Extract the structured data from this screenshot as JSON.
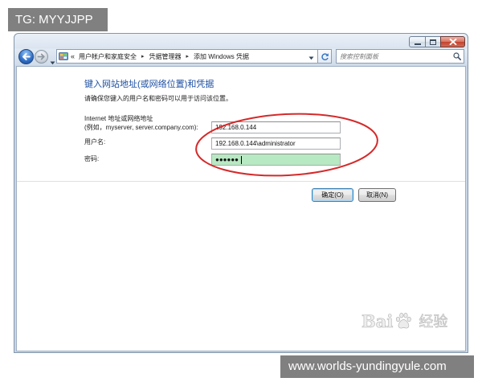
{
  "watermarks": {
    "top_left": "TG: MYYJJPP",
    "bottom_right": "www.worlds-yundingyule.com",
    "baidu_prefix": "Bai",
    "baidu_suffix": "经验"
  },
  "window": {
    "address": {
      "overflow": "«",
      "separator": "▸",
      "breadcrumbs": [
        "用户帐户和家庭安全",
        "凭据管理器",
        "添加 Windows 凭据"
      ]
    },
    "search": {
      "placeholder": "搜索控制面板"
    }
  },
  "form": {
    "heading": "键入网站地址(或网络位置)和凭据",
    "description": "请确保您键入的用户名和密码可以用于访问该位置。",
    "address_label": "Internet 地址或网络地址",
    "address_example": "(例如，myserver, server.company.com):",
    "address_value": "192.168.0.144",
    "username_label": "用户名:",
    "username_value": "192.168.0.144\\administrator",
    "password_label": "密码:",
    "password_value": "●●●●●●"
  },
  "buttons": {
    "ok": "确定(O)",
    "cancel": "取消(N)"
  },
  "icons": {
    "minimize": "minimize-icon",
    "maximize": "maximize-icon",
    "close": "close-icon",
    "back": "back-arrow-icon",
    "forward": "forward-arrow-icon",
    "recent_pages": "chevron-down-icon",
    "location": "control-panel-icon",
    "address_dropdown": "chevron-down-icon",
    "refresh": "refresh-icon",
    "search": "search-icon",
    "baidu": "baidu-paw-icon"
  },
  "colors": {
    "heading": "#1e50a2",
    "password_highlight": "#b7e9c2",
    "annotation": "#d42a2a",
    "watermark_box": "#808080"
  }
}
